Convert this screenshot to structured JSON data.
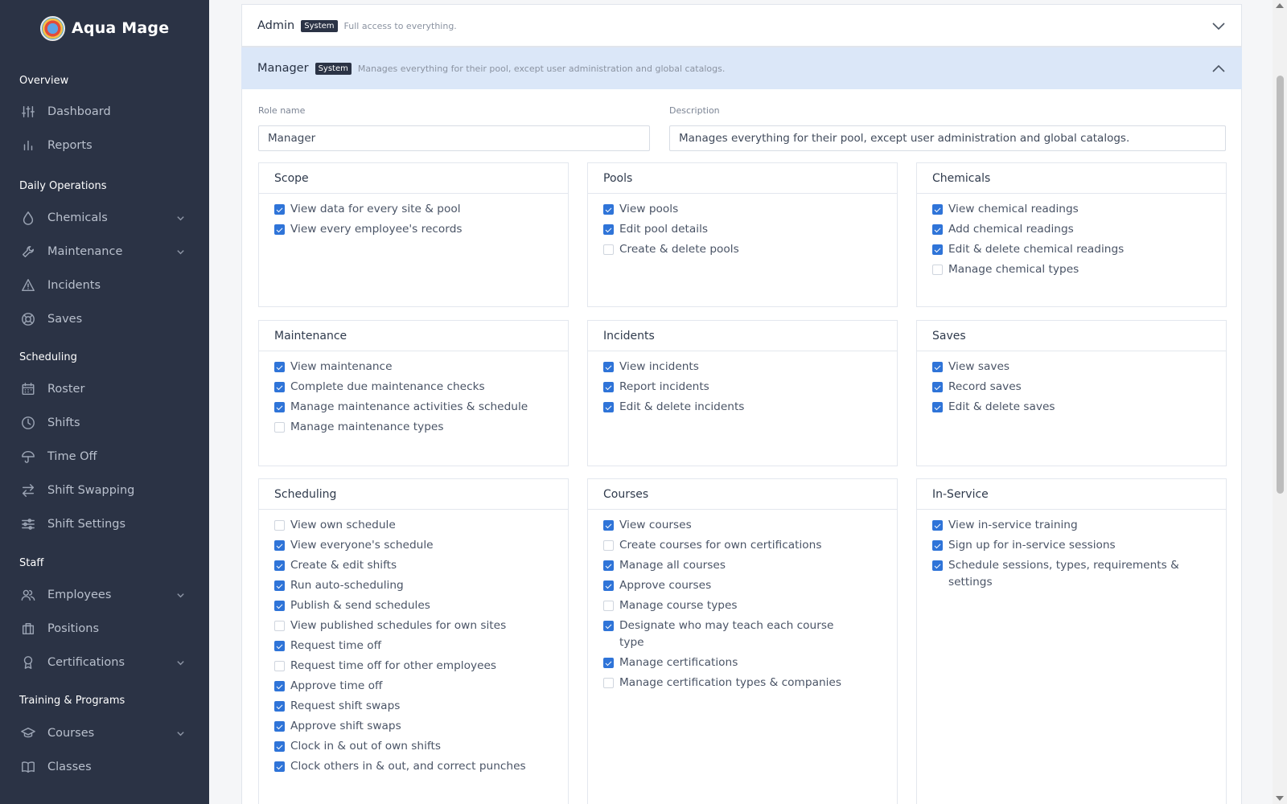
{
  "brand": {
    "name": "Aqua Mage"
  },
  "sidebar": {
    "sections": [
      {
        "title": "Overview",
        "items": [
          {
            "label": "Dashboard",
            "icon": "dashboard-sliders-icon",
            "expandable": false
          },
          {
            "label": "Reports",
            "icon": "bar-chart-icon",
            "expandable": false
          }
        ]
      },
      {
        "title": "Daily Operations",
        "items": [
          {
            "label": "Chemicals",
            "icon": "droplet-icon",
            "expandable": true
          },
          {
            "label": "Maintenance",
            "icon": "wrench-icon",
            "expandable": true
          },
          {
            "label": "Incidents",
            "icon": "warning-triangle-icon",
            "expandable": false
          },
          {
            "label": "Saves",
            "icon": "lifebuoy-icon",
            "expandable": false
          }
        ]
      },
      {
        "title": "Scheduling",
        "items": [
          {
            "label": "Roster",
            "icon": "calendar-icon",
            "expandable": false
          },
          {
            "label": "Shifts",
            "icon": "clock-icon",
            "expandable": false
          },
          {
            "label": "Time Off",
            "icon": "umbrella-icon",
            "expandable": false
          },
          {
            "label": "Shift Swapping",
            "icon": "swap-arrows-icon",
            "expandable": false
          },
          {
            "label": "Shift Settings",
            "icon": "settings-sliders-icon",
            "expandable": false
          }
        ]
      },
      {
        "title": "Staff",
        "items": [
          {
            "label": "Employees",
            "icon": "users-icon",
            "expandable": true
          },
          {
            "label": "Positions",
            "icon": "building-icon",
            "expandable": false
          },
          {
            "label": "Certifications",
            "icon": "award-icon",
            "expandable": true
          }
        ]
      },
      {
        "title": "Training & Programs",
        "items": [
          {
            "label": "Courses",
            "icon": "graduation-cap-icon",
            "expandable": true
          },
          {
            "label": "Classes",
            "icon": "book-icon",
            "expandable": false
          }
        ]
      }
    ]
  },
  "roles": {
    "admin": {
      "name": "Admin",
      "badge": "System",
      "description": "Full access to everything.",
      "expanded": false
    },
    "manager": {
      "name": "Manager",
      "badge": "System",
      "description": "Manages everything for their pool, except user administration and global catalogs.",
      "expanded": true
    }
  },
  "form": {
    "role_name_label": "Role name",
    "role_name_value": "Manager",
    "description_label": "Description",
    "description_value": "Manages everything for their pool, except user administration and global catalogs."
  },
  "permission_groups": [
    {
      "title": "Scope",
      "perms": [
        {
          "label": "View data for every site & pool",
          "checked": true
        },
        {
          "label": "View every employee's records",
          "checked": true
        }
      ]
    },
    {
      "title": "Pools",
      "perms": [
        {
          "label": "View pools",
          "checked": true
        },
        {
          "label": "Edit pool details",
          "checked": true
        },
        {
          "label": "Create & delete pools",
          "checked": false
        }
      ]
    },
    {
      "title": "Chemicals",
      "perms": [
        {
          "label": "View chemical readings",
          "checked": true
        },
        {
          "label": "Add chemical readings",
          "checked": true
        },
        {
          "label": "Edit & delete chemical readings",
          "checked": true
        },
        {
          "label": "Manage chemical types",
          "checked": false
        }
      ]
    },
    {
      "title": "Maintenance",
      "perms": [
        {
          "label": "View maintenance",
          "checked": true
        },
        {
          "label": "Complete due maintenance checks",
          "checked": true
        },
        {
          "label": "Manage maintenance activities & schedule",
          "checked": true
        },
        {
          "label": "Manage maintenance types",
          "checked": false
        }
      ]
    },
    {
      "title": "Incidents",
      "perms": [
        {
          "label": "View incidents",
          "checked": true
        },
        {
          "label": "Report incidents",
          "checked": true
        },
        {
          "label": "Edit & delete incidents",
          "checked": true
        }
      ]
    },
    {
      "title": "Saves",
      "perms": [
        {
          "label": "View saves",
          "checked": true
        },
        {
          "label": "Record saves",
          "checked": true
        },
        {
          "label": "Edit & delete saves",
          "checked": true
        }
      ]
    },
    {
      "title": "Scheduling",
      "perms": [
        {
          "label": "View own schedule",
          "checked": false
        },
        {
          "label": "View everyone's schedule",
          "checked": true
        },
        {
          "label": "Create & edit shifts",
          "checked": true
        },
        {
          "label": "Run auto-scheduling",
          "checked": true
        },
        {
          "label": "Publish & send schedules",
          "checked": true
        },
        {
          "label": "View published schedules for own sites",
          "checked": false
        },
        {
          "label": "Request time off",
          "checked": true
        },
        {
          "label": "Request time off for other employees",
          "checked": false
        },
        {
          "label": "Approve time off",
          "checked": true
        },
        {
          "label": "Request shift swaps",
          "checked": true
        },
        {
          "label": "Approve shift swaps",
          "checked": true
        },
        {
          "label": "Clock in & out of own shifts",
          "checked": true
        },
        {
          "label": "Clock others in & out, and correct punches",
          "checked": true
        }
      ]
    },
    {
      "title": "Courses",
      "perms": [
        {
          "label": "View courses",
          "checked": true
        },
        {
          "label": "Create courses for own certifications",
          "checked": false
        },
        {
          "label": "Manage all courses",
          "checked": true
        },
        {
          "label": "Approve courses",
          "checked": true
        },
        {
          "label": "Manage course types",
          "checked": false
        },
        {
          "label": "Designate who may teach each course type",
          "checked": true
        },
        {
          "label": "Manage certifications",
          "checked": true
        },
        {
          "label": "Manage certification types & companies",
          "checked": false
        }
      ]
    },
    {
      "title": "In-Service",
      "perms": [
        {
          "label": "View in-service training",
          "checked": true
        },
        {
          "label": "Sign up for in-service sessions",
          "checked": true
        },
        {
          "label": "Schedule sessions, types, requirements & settings",
          "checked": true
        }
      ]
    }
  ],
  "colors": {
    "sidebar_bg": "#2b3345",
    "accent": "#2f74d8",
    "expanded_row_bg": "#dbe7f8"
  }
}
